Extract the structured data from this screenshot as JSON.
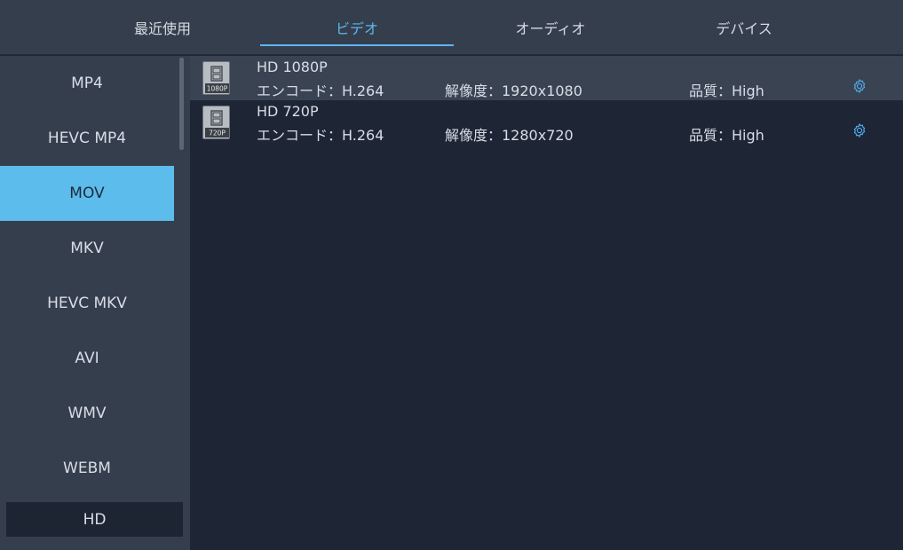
{
  "tabs": [
    {
      "label": "最近使用",
      "active": false
    },
    {
      "label": "ビデオ",
      "active": true
    },
    {
      "label": "オーディオ",
      "active": false
    },
    {
      "label": "デバイス",
      "active": false
    }
  ],
  "sidebar": {
    "items": [
      {
        "label": "MP4",
        "active": false
      },
      {
        "label": "HEVC MP4",
        "active": false
      },
      {
        "label": "MOV",
        "active": true
      },
      {
        "label": "MKV",
        "active": false
      },
      {
        "label": "HEVC MKV",
        "active": false
      },
      {
        "label": "AVI",
        "active": false
      },
      {
        "label": "WMV",
        "active": false
      },
      {
        "label": "WEBM",
        "active": false
      }
    ],
    "bottom_label": "HD"
  },
  "presets": [
    {
      "icon_label": "1080P",
      "title": "HD 1080P",
      "encode": "エンコード：H.264",
      "resolution": "解像度：1920x1080",
      "quality": "品質：High",
      "selected": true
    },
    {
      "icon_label": "720P",
      "title": "HD 720P",
      "encode": "エンコード：H.264",
      "resolution": "解像度：1280x720",
      "quality": "品質：High",
      "selected": false
    }
  ],
  "colors": {
    "accent": "#5eb6ee",
    "active_item_bg": "#5cbcec",
    "sidebar_bg": "#353e4d",
    "content_bg": "#1e2535",
    "selected_row_bg": "#3a4352"
  },
  "icons": {
    "preset_file": "video-file-icon",
    "settings": "gear-icon"
  }
}
